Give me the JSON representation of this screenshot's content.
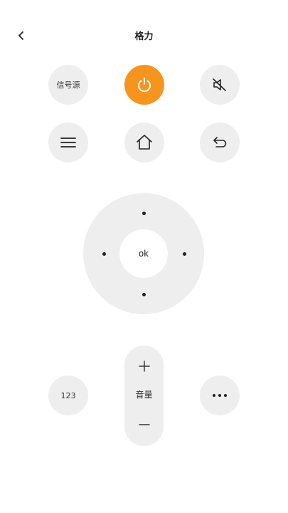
{
  "header": {
    "title": "格力",
    "back_icon": "chevron-left-icon"
  },
  "buttons": {
    "source_label": "信号源",
    "power_icon": "power-icon",
    "mute_icon": "mute-icon",
    "menu_icon": "menu-icon",
    "home_icon": "home-icon",
    "return_icon": "return-icon",
    "numpad_label": "123",
    "more_icon": "more-icon"
  },
  "dpad": {
    "ok_label": "ok"
  },
  "volume": {
    "label": "音量",
    "up_icon": "plus-icon",
    "down_icon": "minus-icon"
  },
  "colors": {
    "accent": "#f7941e",
    "button_bg": "#eeeeee",
    "background": "#ffffff"
  }
}
